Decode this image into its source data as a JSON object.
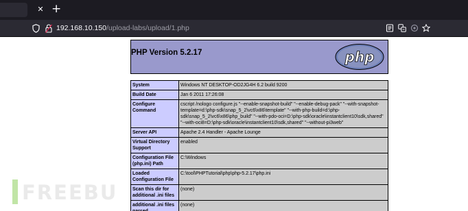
{
  "browser": {
    "tab_close_glyph": "✕",
    "new_tab_glyph": "+",
    "url_host": "192.168.10.150",
    "url_path": "/upload-labs/upload/1.php",
    "toolbar_icons": [
      "reader-view-icon",
      "translate-icon",
      "extensions-icon",
      "bookmark-star-icon"
    ]
  },
  "phpinfo": {
    "title": "PHP Version 5.2.17",
    "logo_text": "php",
    "rows": [
      {
        "key": "System",
        "value": "Windows NT DESKTOP-OD2JG4H 6.2 build 9200"
      },
      {
        "key": "Build Date",
        "value": "Jan 6 2011 17:26:08"
      },
      {
        "key": "Configure Command",
        "value": "cscript /nologo configure.js \"--enable-snapshot-build\" \"--enable-debug-pack\" \"--with-snapshot-template=d:\\php-sdk\\snap_5_2\\vc6\\x86\\template\" \"--with-php-build=d:\\php-sdk\\snap_5_2\\vc6\\x86\\php_build\" \"--with-pdo-oci=D:\\php-sdk\\oracle\\instantclient10\\sdk,shared\" \"--with-oci8=D:\\php-sdk\\oracle\\instantclient10\\sdk,shared\" \"--without-pi3web\""
      },
      {
        "key": "Server API",
        "value": "Apache 2.4 Handler - Apache Lounge"
      },
      {
        "key": "Virtual Directory Support",
        "value": "enabled"
      },
      {
        "key": "Configuration File (php.ini) Path",
        "value": "C:\\Windows"
      },
      {
        "key": "Loaded Configuration File",
        "value": "C:\\tool\\PHPTutorial\\php\\php-5.2.17\\php.ini"
      },
      {
        "key": "Scan this dir for additional .ini files",
        "value": "(none)"
      },
      {
        "key": "additional .ini files parsed",
        "value": "(none)"
      }
    ]
  },
  "watermark": {
    "text": "FREEBU"
  },
  "colors": {
    "header_bg": "#9999cc",
    "key_cell_bg": "#ccccff",
    "value_cell_bg": "#cccccc",
    "browser_chrome": "#2b2a33",
    "tab_strip": "#1c1b22"
  }
}
